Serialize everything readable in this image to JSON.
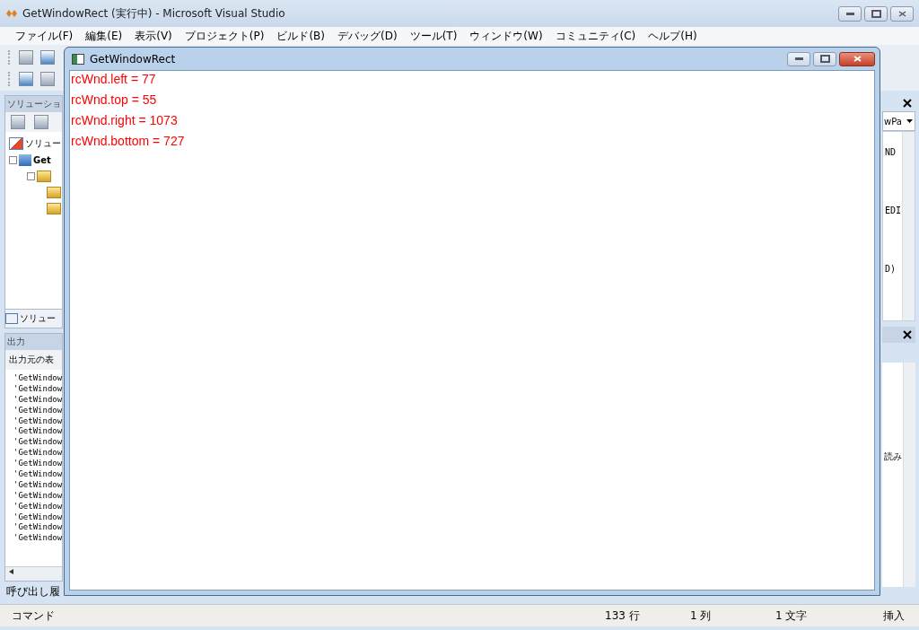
{
  "window": {
    "title": "GetWindowRect (実行中) - Microsoft Visual Studio"
  },
  "menu": [
    "ファイル(F)",
    "編集(E)",
    "表示(V)",
    "プロジェクト(P)",
    "ビルド(B)",
    "デバッグ(D)",
    "ツール(T)",
    "ウィンドウ(W)",
    "コミュニティ(C)",
    "ヘルプ(H)"
  ],
  "solution_explorer": {
    "title": "ソリューショ",
    "tree": [
      {
        "label": "ソリュー",
        "children": [
          {
            "label": "Get"
          }
        ]
      }
    ],
    "tab": "ソリュー"
  },
  "output": {
    "title": "出力",
    "source_label": "出力元の表",
    "lines": [
      "'GetWindow",
      "'GetWindow",
      "'GetWindow",
      "'GetWindow",
      "'GetWindow",
      "'GetWindow",
      "'GetWindow",
      "'GetWindow",
      "'GetWindow",
      "'GetWindow",
      "'GetWindow",
      "'GetWindow",
      "'GetWindow",
      "'GetWindow",
      "'GetWindow",
      "'GetWindow"
    ]
  },
  "bottom_tab": "呼び出し履",
  "class_view": {
    "dropdown": "wPa",
    "lines": [
      "ND",
      "EDI",
      "D)"
    ]
  },
  "right_output": {
    "text": "読み"
  },
  "status_bar": {
    "mode": "コマンド",
    "line": "133 行",
    "column": "1 列",
    "char": "1 文字",
    "insert": "挿入"
  },
  "dialog": {
    "title": "GetWindowRect",
    "lines": [
      "rcWnd.left = 77",
      "rcWnd.top = 55",
      "rcWnd.right = 1073",
      "rcWnd.bottom = 727"
    ]
  }
}
